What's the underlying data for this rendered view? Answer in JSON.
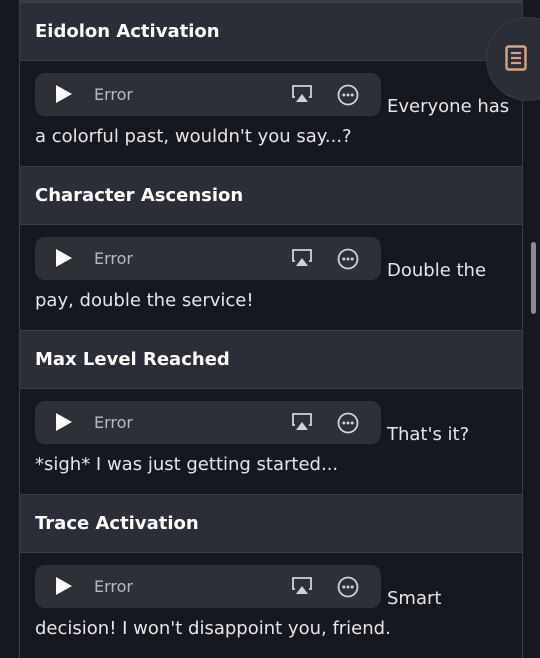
{
  "sections": [
    {
      "title": "Eidolon Activation",
      "player_status": "Error",
      "quote_first": "Everyone has",
      "quote_rest": "a colorful past, wouldn't you say...?"
    },
    {
      "title": "Character Ascension",
      "player_status": "Error",
      "quote_first": "Double the",
      "quote_rest": "pay, double the service!"
    },
    {
      "title": "Max Level Reached",
      "player_status": "Error",
      "quote_first": "That's it?",
      "quote_rest": "*sigh* I was just getting started..."
    },
    {
      "title": "Trace Activation",
      "player_status": "Error",
      "quote_first": "Smart",
      "quote_rest": "decision! I won't disappoint you, friend."
    }
  ],
  "icons": {
    "play": "play-icon",
    "airplay": "airplay-icon",
    "more": "more-options-icon",
    "fab": "table-of-contents-icon"
  },
  "colors": {
    "background": "#16181f",
    "header_bg": "#2b2e37",
    "player_bg": "#2e3038",
    "border": "#3a3d47",
    "accent_icon": "#d8a47f"
  }
}
